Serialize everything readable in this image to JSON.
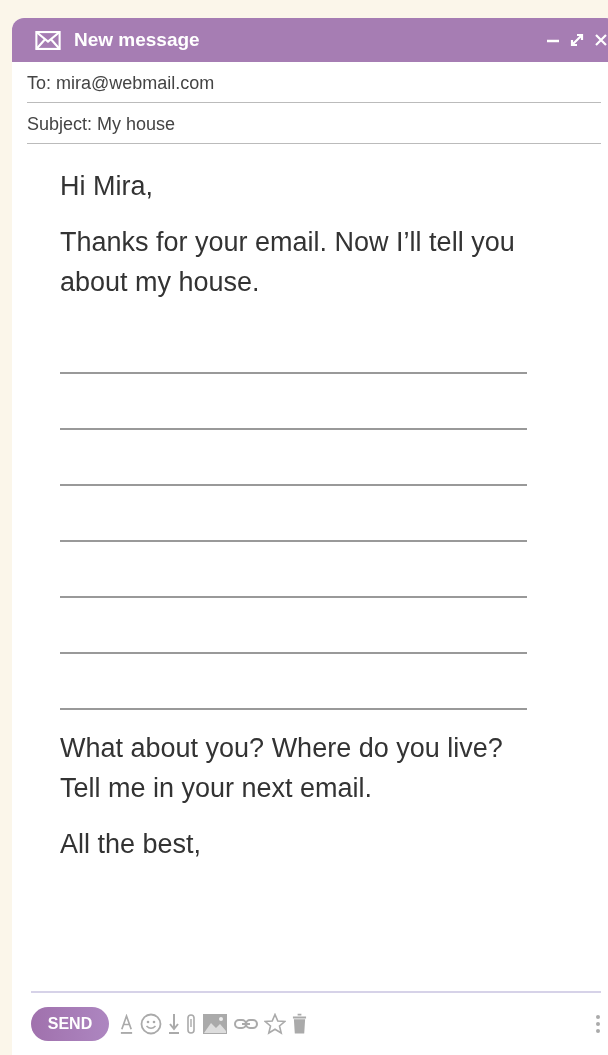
{
  "window": {
    "title": "New message"
  },
  "to": "To: mira@webmail.com",
  "subject": "Subject: My house",
  "body": [
    {
      "kind": "text",
      "text": "Hi Mira,"
    },
    {
      "kind": "text",
      "text": "Thanks for your email. Now I’ll tell you about my house."
    },
    {
      "kind": "answer_line"
    },
    {
      "kind": "answer_line"
    },
    {
      "kind": "answer_line"
    },
    {
      "kind": "answer_line"
    },
    {
      "kind": "answer_line"
    },
    {
      "kind": "answer_line"
    },
    {
      "kind": "answer_line"
    },
    {
      "kind": "text",
      "text": "What about you? Where do you live? Tell me in your next email."
    },
    {
      "kind": "text",
      "text": "All the best,"
    }
  ],
  "send_button": "SEND"
}
